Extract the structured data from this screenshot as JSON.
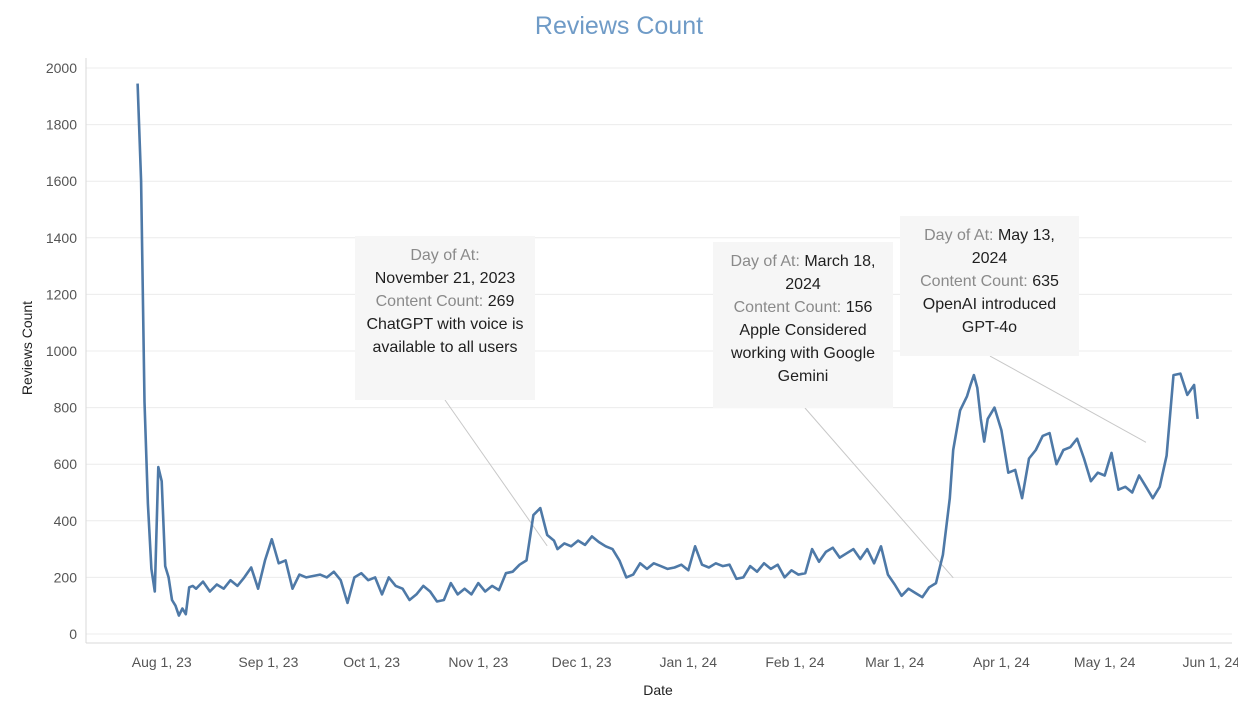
{
  "chart_data": {
    "type": "line",
    "title": "Reviews Count",
    "xlabel": "Date",
    "ylabel": "Reviews Count",
    "ylim": [
      0,
      2000
    ],
    "yticks": [
      0,
      200,
      400,
      600,
      800,
      1000,
      1200,
      1400,
      1600,
      1800,
      2000
    ],
    "xlim": [
      "2023-07-10",
      "2024-06-07"
    ],
    "xticks": [
      {
        "date": "2023-08-01",
        "label": "Aug 1, 23"
      },
      {
        "date": "2023-09-01",
        "label": "Sep 1, 23"
      },
      {
        "date": "2023-10-01",
        "label": "Oct 1, 23"
      },
      {
        "date": "2023-11-01",
        "label": "Nov 1, 23"
      },
      {
        "date": "2023-12-01",
        "label": "Dec 1, 23"
      },
      {
        "date": "2024-01-01",
        "label": "Jan 1, 24"
      },
      {
        "date": "2024-02-01",
        "label": "Feb 1, 24"
      },
      {
        "date": "2024-03-01",
        "label": "Mar 1, 24"
      },
      {
        "date": "2024-04-01",
        "label": "Apr 1, 24"
      },
      {
        "date": "2024-05-01",
        "label": "May 1, 24"
      },
      {
        "date": "2024-06-01",
        "label": "Jun 1, 24"
      }
    ],
    "grid": true,
    "line_color": "#4e79a7",
    "x": [
      "2023-07-25",
      "2023-07-26",
      "2023-07-27",
      "2023-07-28",
      "2023-07-29",
      "2023-07-30",
      "2023-07-31",
      "2023-08-01",
      "2023-08-02",
      "2023-08-03",
      "2023-08-04",
      "2023-08-05",
      "2023-08-06",
      "2023-08-07",
      "2023-08-08",
      "2023-08-09",
      "2023-08-10",
      "2023-08-11",
      "2023-08-13",
      "2023-08-15",
      "2023-08-17",
      "2023-08-19",
      "2023-08-21",
      "2023-08-23",
      "2023-08-25",
      "2023-08-27",
      "2023-08-29",
      "2023-08-31",
      "2023-09-02",
      "2023-09-04",
      "2023-09-06",
      "2023-09-08",
      "2023-09-10",
      "2023-09-12",
      "2023-09-14",
      "2023-09-16",
      "2023-09-18",
      "2023-09-20",
      "2023-09-22",
      "2023-09-24",
      "2023-09-26",
      "2023-09-28",
      "2023-09-30",
      "2023-10-02",
      "2023-10-04",
      "2023-10-06",
      "2023-10-08",
      "2023-10-10",
      "2023-10-12",
      "2023-10-14",
      "2023-10-16",
      "2023-10-18",
      "2023-10-20",
      "2023-10-22",
      "2023-10-24",
      "2023-10-26",
      "2023-10-28",
      "2023-10-30",
      "2023-11-01",
      "2023-11-03",
      "2023-11-05",
      "2023-11-07",
      "2023-11-09",
      "2023-11-11",
      "2023-11-13",
      "2023-11-15",
      "2023-11-17",
      "2023-11-19",
      "2023-11-21",
      "2023-11-23",
      "2023-11-24",
      "2023-11-26",
      "2023-11-28",
      "2023-11-30",
      "2023-12-02",
      "2023-12-04",
      "2023-12-06",
      "2023-12-08",
      "2023-12-10",
      "2023-12-12",
      "2023-12-14",
      "2023-12-16",
      "2023-12-18",
      "2023-12-20",
      "2023-12-22",
      "2023-12-24",
      "2023-12-26",
      "2023-12-28",
      "2023-12-30",
      "2024-01-01",
      "2024-01-03",
      "2024-01-05",
      "2024-01-07",
      "2024-01-09",
      "2024-01-11",
      "2024-01-13",
      "2024-01-15",
      "2024-01-17",
      "2024-01-19",
      "2024-01-21",
      "2024-01-23",
      "2024-01-25",
      "2024-01-27",
      "2024-01-29",
      "2024-01-31",
      "2024-02-02",
      "2024-02-04",
      "2024-02-06",
      "2024-02-08",
      "2024-02-10",
      "2024-02-12",
      "2024-02-14",
      "2024-02-16",
      "2024-02-18",
      "2024-02-20",
      "2024-02-22",
      "2024-02-24",
      "2024-02-26",
      "2024-02-28",
      "2024-03-01",
      "2024-03-03",
      "2024-03-05",
      "2024-03-07",
      "2024-03-09",
      "2024-03-11",
      "2024-03-13",
      "2024-03-15",
      "2024-03-17",
      "2024-03-18",
      "2024-03-20",
      "2024-03-22",
      "2024-03-23",
      "2024-03-24",
      "2024-03-25",
      "2024-03-26",
      "2024-03-27",
      "2024-03-28",
      "2024-03-30",
      "2024-04-01",
      "2024-04-03",
      "2024-04-05",
      "2024-04-07",
      "2024-04-09",
      "2024-04-11",
      "2024-04-13",
      "2024-04-15",
      "2024-04-17",
      "2024-04-19",
      "2024-04-21",
      "2024-04-23",
      "2024-04-25",
      "2024-04-27",
      "2024-04-29",
      "2024-05-01",
      "2024-05-03",
      "2024-05-05",
      "2024-05-07",
      "2024-05-09",
      "2024-05-11",
      "2024-05-13",
      "2024-05-15",
      "2024-05-17",
      "2024-05-19",
      "2024-05-21",
      "2024-05-23",
      "2024-05-25",
      "2024-05-27",
      "2024-05-28"
    ],
    "y": [
      1945,
      1600,
      820,
      460,
      230,
      150,
      590,
      540,
      240,
      200,
      120,
      100,
      65,
      90,
      70,
      165,
      170,
      160,
      185,
      150,
      175,
      160,
      190,
      170,
      200,
      235,
      160,
      260,
      335,
      250,
      260,
      160,
      210,
      200,
      205,
      210,
      200,
      220,
      190,
      110,
      200,
      215,
      190,
      200,
      140,
      200,
      170,
      160,
      120,
      140,
      170,
      150,
      115,
      120,
      180,
      140,
      160,
      140,
      180,
      150,
      170,
      155,
      215,
      220,
      245,
      260,
      420,
      445,
      350,
      330,
      300,
      320,
      310,
      330,
      315,
      345,
      325,
      310,
      300,
      260,
      200,
      210,
      250,
      230,
      250,
      240,
      230,
      235,
      245,
      225,
      310,
      245,
      235,
      250,
      240,
      245,
      195,
      200,
      240,
      220,
      250,
      230,
      245,
      200,
      225,
      210,
      215,
      300,
      255,
      290,
      305,
      270,
      285,
      300,
      265,
      300,
      250,
      310,
      210,
      175,
      135,
      160,
      145,
      130,
      165,
      180,
      280,
      480,
      650,
      790,
      840,
      880,
      915,
      870,
      760,
      680,
      760,
      800,
      720,
      570,
      580,
      480,
      620,
      650,
      700,
      710,
      600,
      650,
      660,
      690,
      620,
      540,
      570,
      560,
      640,
      510,
      520,
      500,
      560,
      520,
      480,
      520,
      630,
      915,
      920,
      845,
      880,
      760
    ]
  },
  "annotations": [
    {
      "day_label": "Day of At:",
      "date": "November 21, 2023",
      "count_label": "Content Count:",
      "count": "269",
      "text": "ChatGPT with voice is available to all users",
      "point_date": "2023-11-21",
      "point_value": 269
    },
    {
      "day_label": "Day of At:",
      "date": "March 18, 2024",
      "count_label": "Content Count:",
      "count": "156",
      "text": "Apple Considered working with Google Gemini",
      "point_date": "2024-03-18",
      "point_value": 156
    },
    {
      "day_label": "Day of At:",
      "date": "May 13, 2024",
      "count_label": "Content Count:",
      "count": "635",
      "text": "OpenAI introduced GPT-4o",
      "point_date": "2024-05-13",
      "point_value": 635
    }
  ]
}
